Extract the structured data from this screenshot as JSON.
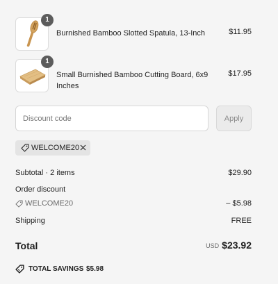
{
  "line_items": [
    {
      "quantity": "1",
      "name": "Burnished Bamboo Slotted Spatula, 13-Inch",
      "price": "$11.95",
      "thumbnail_icon": "spatula-image"
    },
    {
      "quantity": "1",
      "name": "Small Burnished Bamboo Cutting Board, 6x9 Inches",
      "price": "$17.95",
      "thumbnail_icon": "cutting-board-image"
    }
  ],
  "discount": {
    "placeholder": "Discount code",
    "apply_label": "Apply",
    "applied_code": "WELCOME20"
  },
  "summary": {
    "subtotal_label": "Subtotal · 2 items",
    "subtotal_value": "$29.90",
    "order_discount_label": "Order discount",
    "discount_code": "WELCOME20",
    "discount_value": "– $5.98",
    "shipping_label": "Shipping",
    "shipping_value": "FREE",
    "total_label": "Total",
    "currency": "USD",
    "total_value": "$23.92",
    "savings_label": "TOTAL SAVINGS",
    "savings_value": "$5.98"
  },
  "colors": {
    "background": "#f5f5f5",
    "badge": "#5c5c5c",
    "chip": "#e4e4e4"
  }
}
